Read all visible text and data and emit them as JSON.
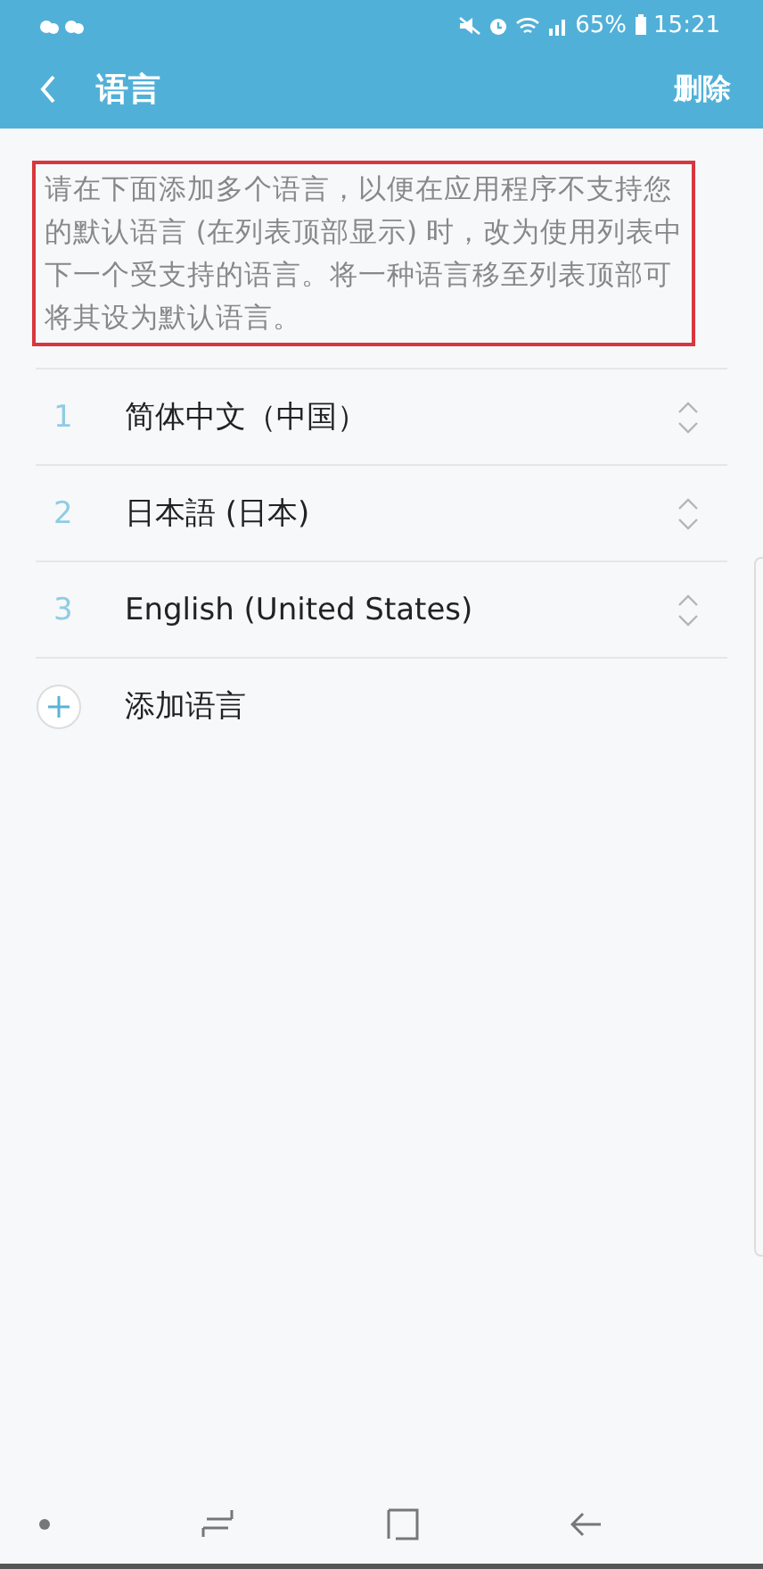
{
  "status_bar": {
    "battery": "65%",
    "time": "15:21"
  },
  "app_bar": {
    "title": "语言",
    "action": "删除"
  },
  "description": {
    "text": "请在下面添加多个语言，以便在应用程序不支持您的默认语言 (在列表顶部显示) 时，改为使用列表中下一个受支持的语言。将一种语言移至列表顶部可将其设为默认语言。",
    "highlighted": true
  },
  "languages": [
    {
      "number": "1",
      "name": "简体中文（中国）"
    },
    {
      "number": "2",
      "name": "日本語 (日本)"
    },
    {
      "number": "3",
      "name": "English (United States)"
    }
  ],
  "add_language": "添加语言"
}
